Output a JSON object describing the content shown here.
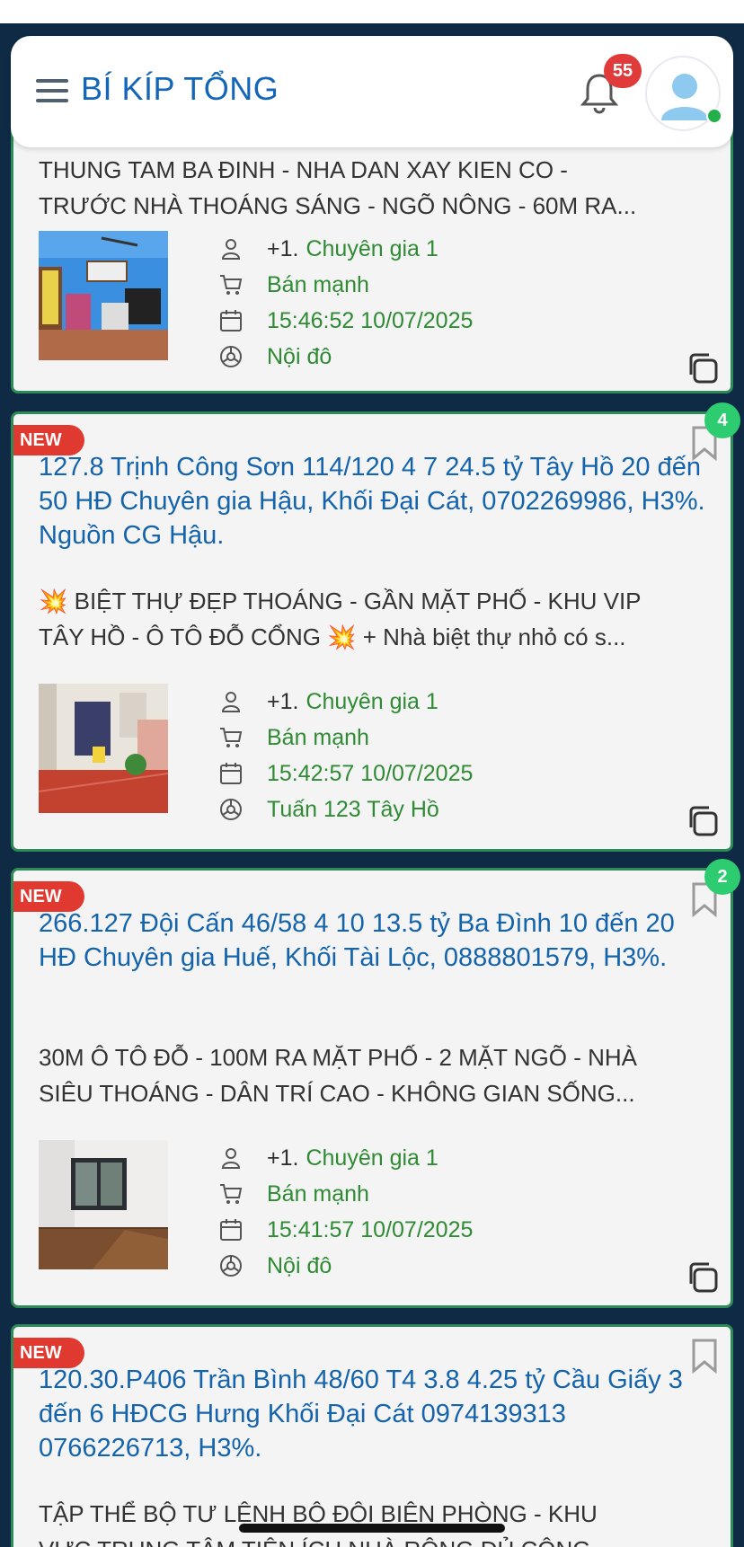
{
  "header": {
    "title": "BÍ KÍP TỔNG",
    "notification_count": "55"
  },
  "cards": [
    {
      "title": "",
      "desc_lines": [
        "THUNG TAM BA ĐINH - NHA DAN XAY KIEN CO -",
        "TRƯỚC NHÀ THOÁNG SÁNG - NGÕ NÔNG - 60M RA..."
      ],
      "meta": {
        "agent_prefix": "+1.",
        "agent": "Chuyên gia 1",
        "status": "Bán mạnh",
        "datetime": "15:46:52 10/07/2025",
        "area": "Nội đô"
      }
    },
    {
      "new_label": "NEW",
      "count": "4",
      "title": "127.8 Trịnh Công Sơn 114/120 4 7 24.5 tỷ Tây Hồ 20 đến 50 HĐ Chuyên gia Hậu, Khối Đại Cát, 0702269986, H3%. Nguồn CG Hậu.",
      "desc_lines": [
        "💥 BIỆT THỰ ĐẸP THOÁNG - GẦN MẶT PHỐ - KHU VIP",
        "TÂY HỒ - Ô TÔ ĐỖ CỔNG 💥 + Nhà biệt thự nhỏ có s..."
      ],
      "meta": {
        "agent_prefix": "+1.",
        "agent": "Chuyên gia 1",
        "status": "Bán mạnh",
        "datetime": "15:42:57 10/07/2025",
        "area": "Tuấn 123 Tây Hồ"
      }
    },
    {
      "new_label": "NEW",
      "count": "2",
      "title": "266.127 Đội Cấn 46/58 4 10 13.5 tỷ Ba Đình 10 đến 20 HĐ Chuyên gia Huế, Khối Tài Lộc, 0888801579, H3%.",
      "desc_lines": [
        "30M Ô TÔ ĐỖ - 100M RA MẶT PHỐ - 2 MẶT NGÕ - NHÀ",
        "SIÊU THOÁNG - DÂN TRÍ CAO - KHÔNG GIAN SỐNG..."
      ],
      "meta": {
        "agent_prefix": "+1.",
        "agent": "Chuyên gia 1",
        "status": "Bán mạnh",
        "datetime": "15:41:57 10/07/2025",
        "area": "Nội đô"
      }
    },
    {
      "new_label": "NEW",
      "title": "120.30.P406 Trần Bình 48/60 T4 3.8 4.25 tỷ Cầu Giấy 3 đến 6 HĐCG Hưng Khối Đại Cát 0974139313 0766226713, H3%.",
      "desc_lines": [
        "TẬP THỂ BỘ TƯ LỆNH BỘ ĐỘI BIÊN PHÒNG - KHU",
        "VỰC TRUNG TÂM TIỆN ÍCH NHÀ RỘNG ĐỦ CÔNG"
      ]
    }
  ]
}
